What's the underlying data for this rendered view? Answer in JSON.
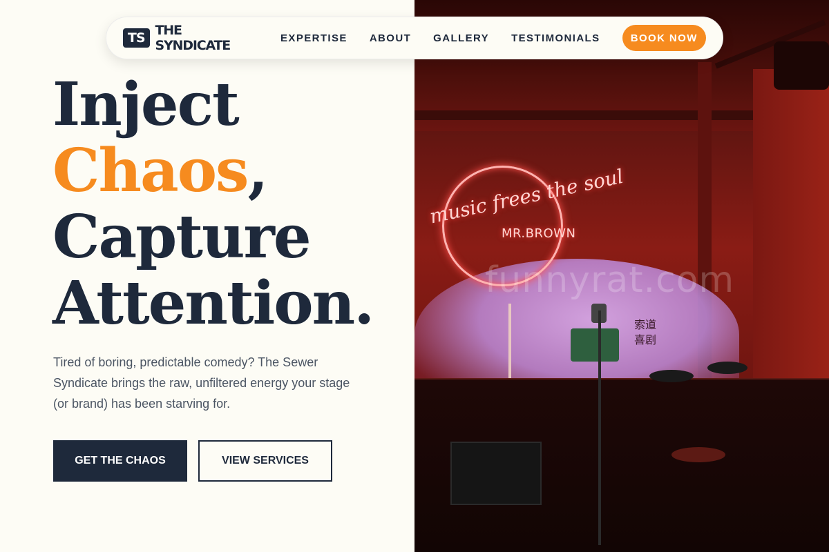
{
  "nav": {
    "logo_badge": "TS",
    "logo_text": "THE SYNDICATE",
    "links": [
      "EXPERTISE",
      "ABOUT",
      "GALLERY",
      "TESTIMONIALS"
    ],
    "cta": "BOOK NOW"
  },
  "hero": {
    "line1": "Inject",
    "line2_accent": "Chaos",
    "line2_rest": ",",
    "line3": "Capture",
    "line4": "Attention.",
    "subtext": "Tired of boring, predictable comedy? The Sewer Syndicate brings the raw, unfiltered energy your stage (or brand) has been starving for.",
    "primary_button": "GET THE CHAOS",
    "secondary_button": "VIEW SERVICES"
  },
  "photo": {
    "neon_text": "music frees the soul",
    "neon_sub": "MR.BROWN",
    "chinese_text": "索道喜剧",
    "watermark": "funnyrat.com"
  },
  "colors": {
    "accent": "#f68b1f",
    "navy": "#1e293b",
    "background": "#fdfcf5"
  }
}
